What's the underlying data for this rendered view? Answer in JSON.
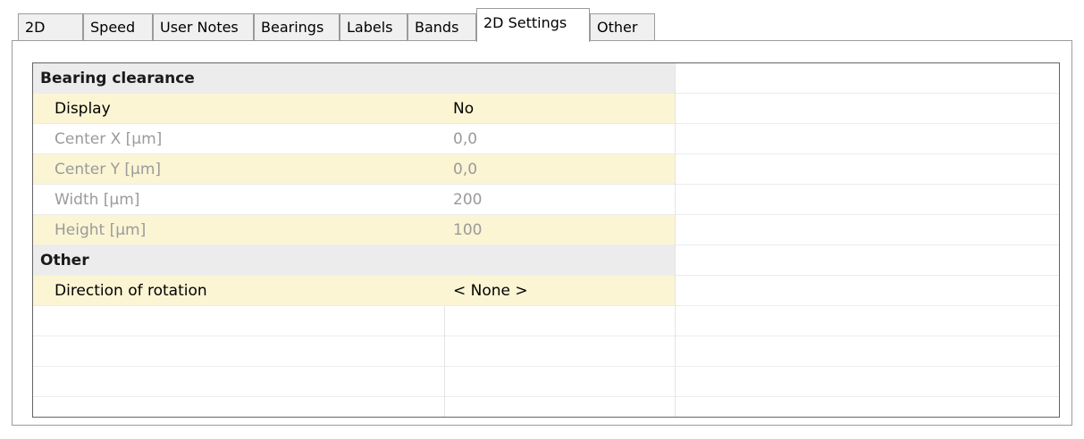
{
  "tabs": [
    {
      "label": "2D",
      "active": false
    },
    {
      "label": "Speed",
      "active": false
    },
    {
      "label": "User Notes",
      "active": false
    },
    {
      "label": "Bearings",
      "active": false
    },
    {
      "label": "Labels",
      "active": false
    },
    {
      "label": "Bands",
      "active": false
    },
    {
      "label": "2D Settings",
      "active": true
    },
    {
      "label": "Other",
      "active": false
    }
  ],
  "property_grid": {
    "category_bearing": "Bearing clearance",
    "display": {
      "name": "Display",
      "value": "No",
      "enabled": true
    },
    "center_x": {
      "name": "Center X [µm]",
      "value": "0,0",
      "enabled": false
    },
    "center_y": {
      "name": "Center Y [µm]",
      "value": "0,0",
      "enabled": false
    },
    "width": {
      "name": "Width [µm]",
      "value": "200",
      "enabled": false
    },
    "height": {
      "name": "Height [µm]",
      "value": "100",
      "enabled": false
    },
    "category_other": "Other",
    "direction": {
      "name": "Direction of rotation",
      "value": "< None >",
      "enabled": true
    }
  },
  "colors": {
    "category_bg": "#ececec",
    "selected_row_bg": "#fbf5d4",
    "disabled_text": "#9a9a9a",
    "border": "#9b9b9b"
  }
}
